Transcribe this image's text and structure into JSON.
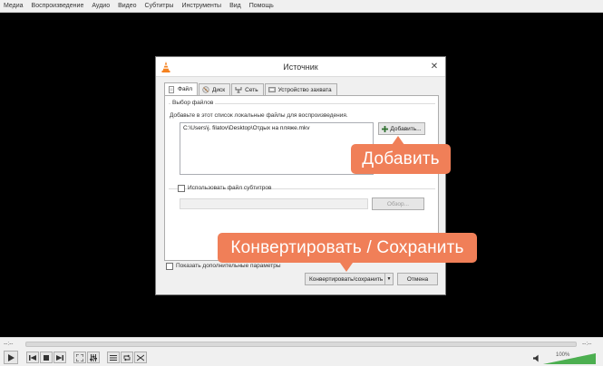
{
  "menubar": {
    "items": [
      "Медиа",
      "Воспроизведение",
      "Аудио",
      "Видео",
      "Субтитры",
      "Инструменты",
      "Вид",
      "Помощь"
    ]
  },
  "dialog": {
    "title": "Источник",
    "tabs": [
      {
        "label": "Файл",
        "active": true
      },
      {
        "label": "Диск",
        "active": false
      },
      {
        "label": "Сеть",
        "active": false
      },
      {
        "label": "Устройство захвата",
        "active": false
      }
    ],
    "file_group": {
      "label": "Выбор файлов",
      "hint": "Добавьте в этот список локальные файлы для воспроизведения.",
      "files": [
        "C:\\Users\\j. filatov\\Desktop\\Отдых на пляже.mkv"
      ],
      "add_button": "Добавить..."
    },
    "subtitles": {
      "checkbox_label": "Использовать файл субтитров",
      "browse_button": "Обзор..."
    },
    "show_more_label": "Показать дополнительные параметры",
    "convert_button": "Конвертировать/сохранить",
    "cancel_button": "Отмена"
  },
  "callouts": {
    "add": "Добавить",
    "convert": "Конвертировать / Сохранить"
  },
  "colors": {
    "callout": "#f07f58",
    "accent_orange": "#f58220"
  },
  "player": {
    "elapsed": "--:--",
    "remaining": "--:--",
    "volume": "100%"
  }
}
